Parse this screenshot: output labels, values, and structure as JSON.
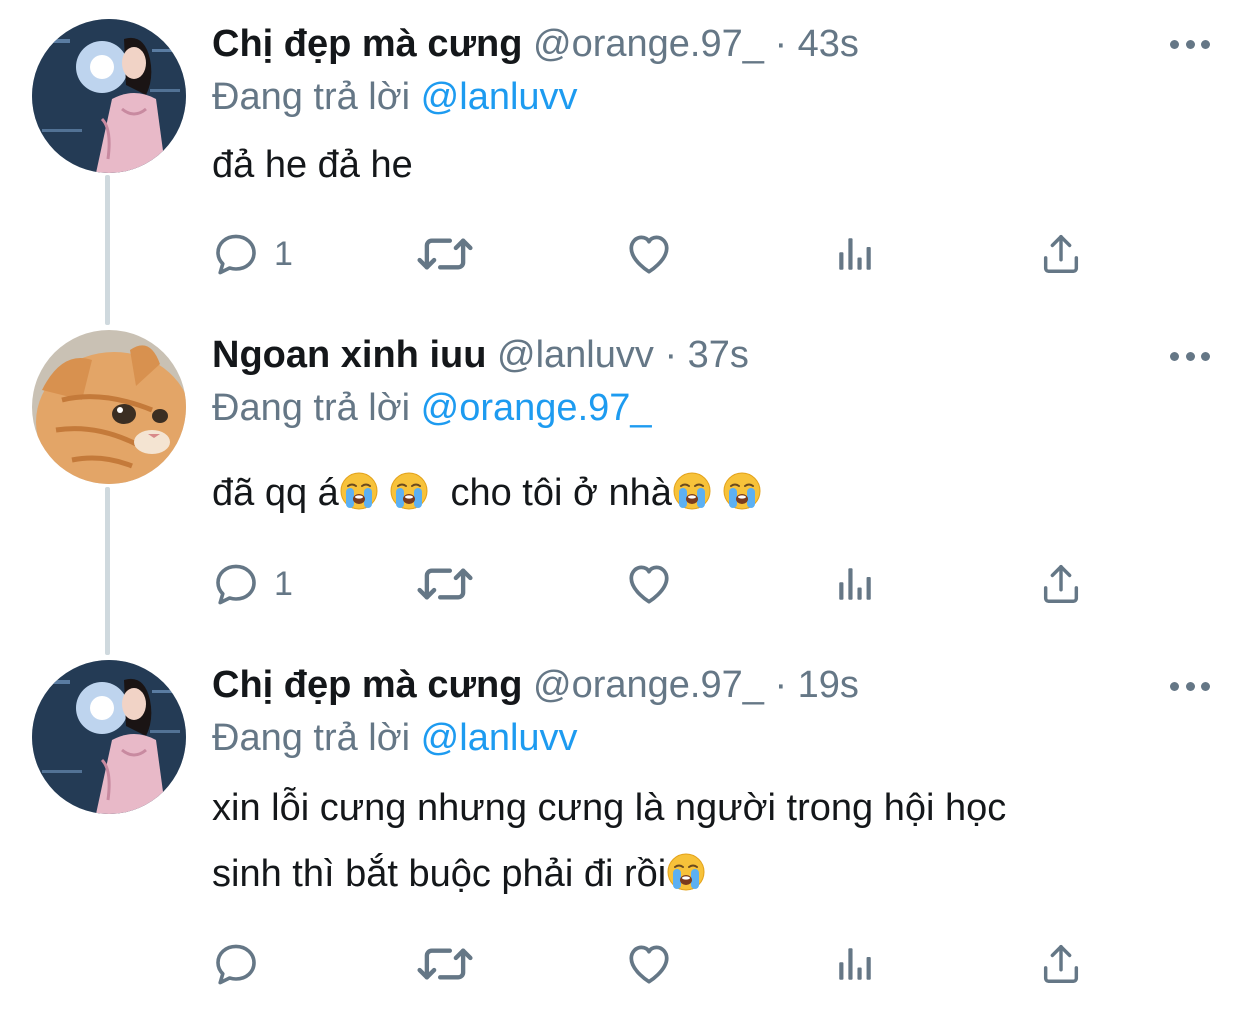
{
  "tweets": [
    {
      "display_name": "Chị đẹp mà cưng",
      "handle": "@orange.97_",
      "separator": "·",
      "time": "43s",
      "replying_to_label": "Đang trả lời",
      "replying_to_handle": "@lanluvv",
      "text": "đả he đả he",
      "reply_count": "1",
      "avatar": "woman-portrait-avatar"
    },
    {
      "display_name": "Ngoan xinh iuu",
      "handle": "@lanluvv",
      "separator": "·",
      "time": "37s",
      "replying_to_label": "Đang trả lời",
      "replying_to_handle": "@orange.97_",
      "text_parts": [
        "đã qq á",
        " ",
        "  cho tôi ở nhà",
        " "
      ],
      "reply_count": "1",
      "avatar": "orange-cat-avatar"
    },
    {
      "display_name": "Chị đẹp mà cưng",
      "handle": "@orange.97_",
      "separator": "·",
      "time": "19s",
      "replying_to_label": "Đang trả lời",
      "replying_to_handle": "@lanluvv",
      "text_line1": "xin lỗi cưng nhưng cưng là người trong hội học",
      "text_line2": "sinh thì bắt buộc phải đi rồi",
      "reply_count": "",
      "avatar": "woman-portrait-avatar"
    }
  ],
  "icons": {
    "reply": "reply-icon",
    "retweet": "retweet-icon",
    "like": "heart-icon",
    "analytics": "analytics-icon",
    "share": "share-icon",
    "more": "more-options-icon",
    "emoji": "loudly-crying-face-emoji"
  },
  "colors": {
    "text": "#14171a",
    "secondary": "#657786",
    "link": "#1d9bf0",
    "thread_line": "#cfd9de"
  }
}
